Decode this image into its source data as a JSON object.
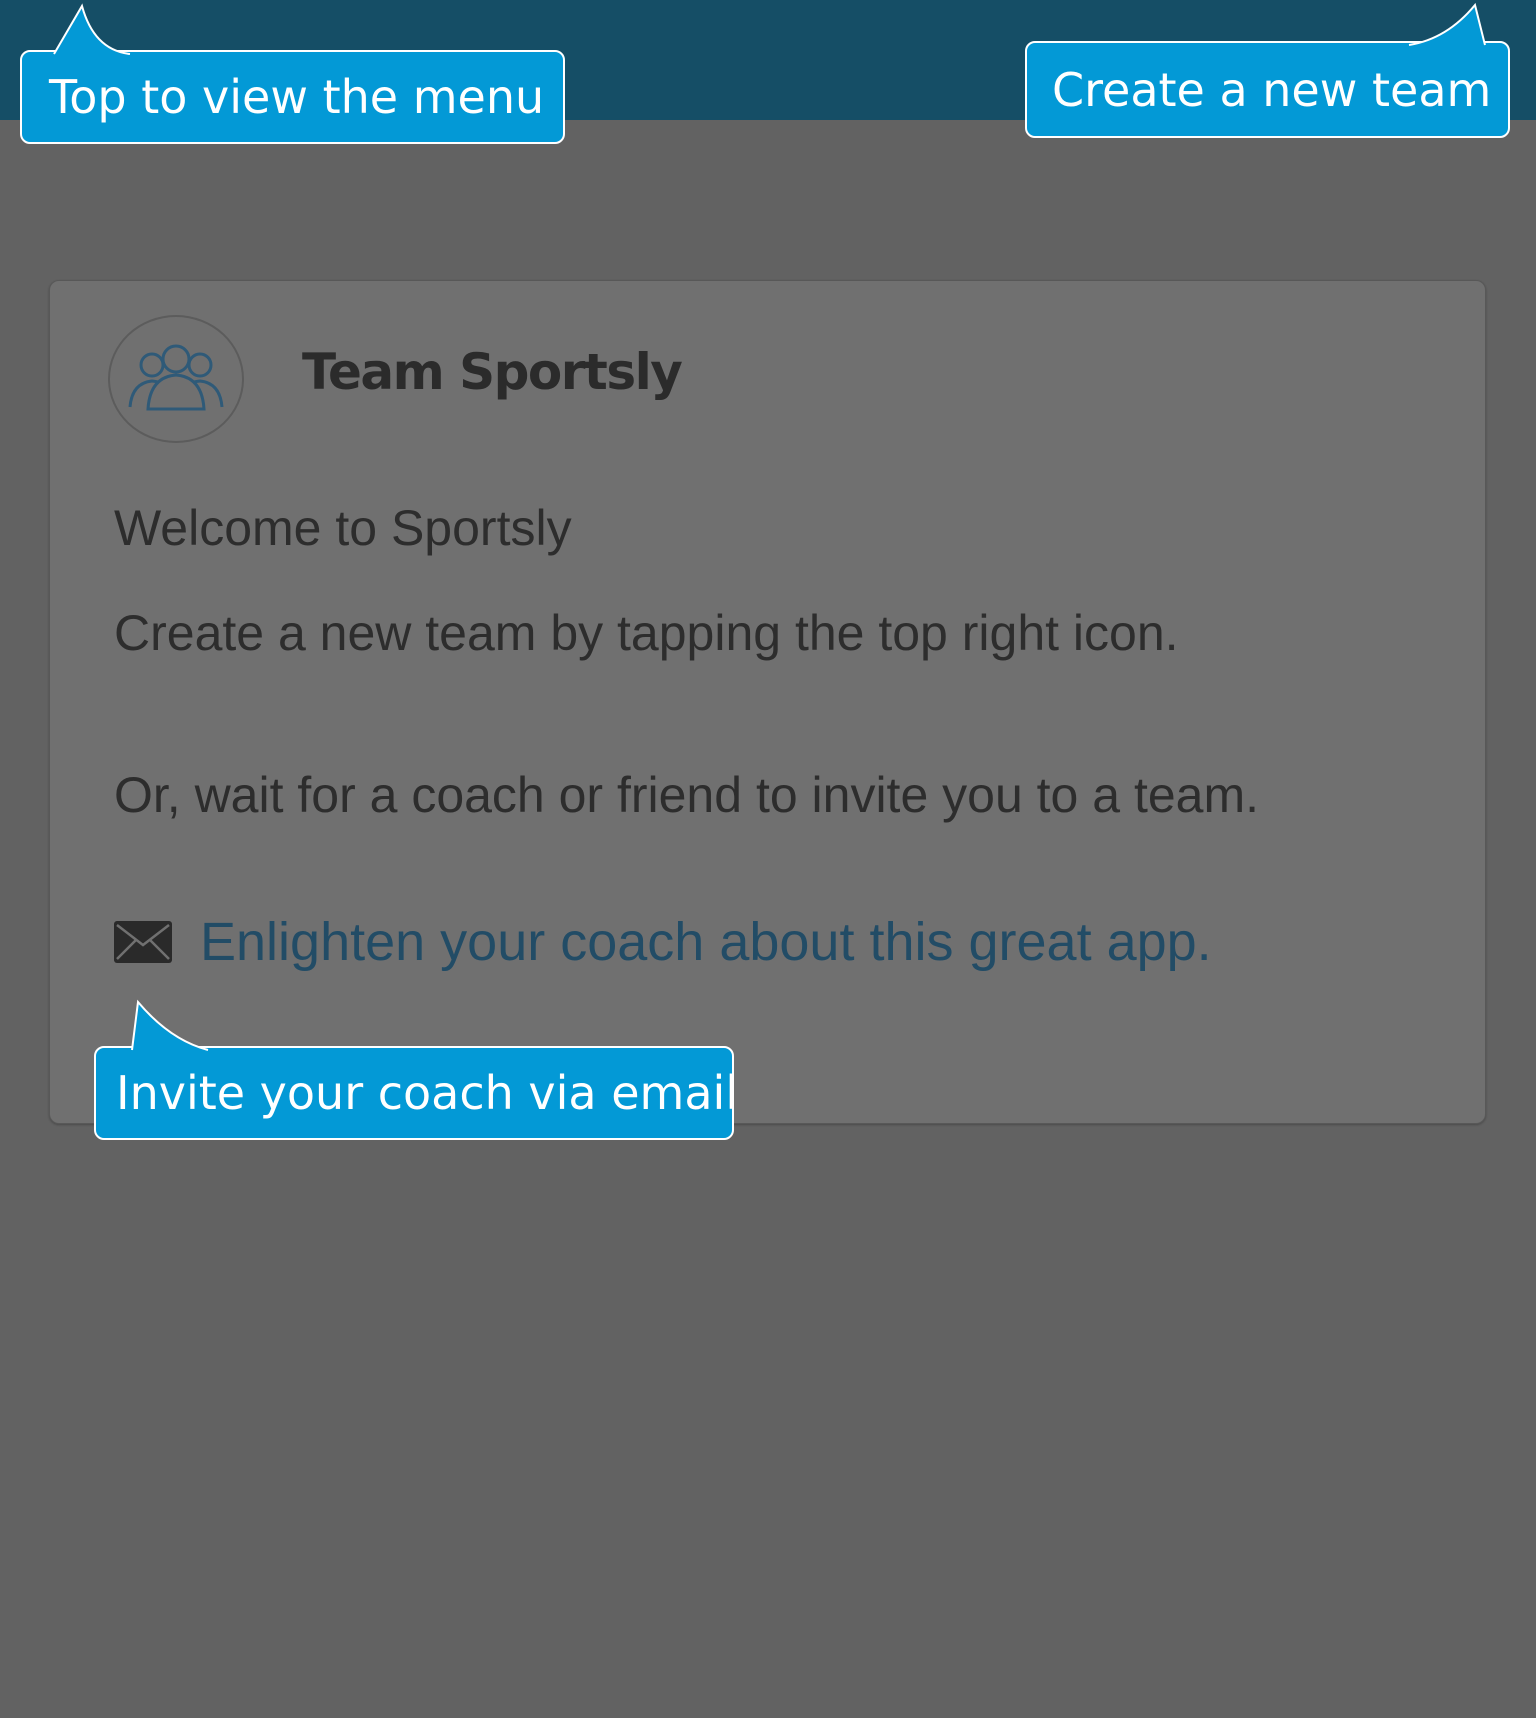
{
  "team": {
    "name": "Team Sportsly",
    "avatar_icon": "team-group-icon"
  },
  "card": {
    "welcome": "Welcome to Sportsly",
    "instruction_create": "Create a new team by tapping the top right icon.",
    "instruction_wait": "Or, wait for a coach or friend to invite you to a team.",
    "invite_link": "Enlighten your coach about this great app.",
    "invite_icon": "mail-icon"
  },
  "tooltips": {
    "menu": "Top to view the menu",
    "create_team": "Create a new team",
    "invite": "Invite your coach via email"
  },
  "colors": {
    "topbar": "#154e66",
    "overlay_background": "#626262",
    "card_background": "#707070",
    "tooltip": "#0399d6",
    "link": "#224c66"
  }
}
